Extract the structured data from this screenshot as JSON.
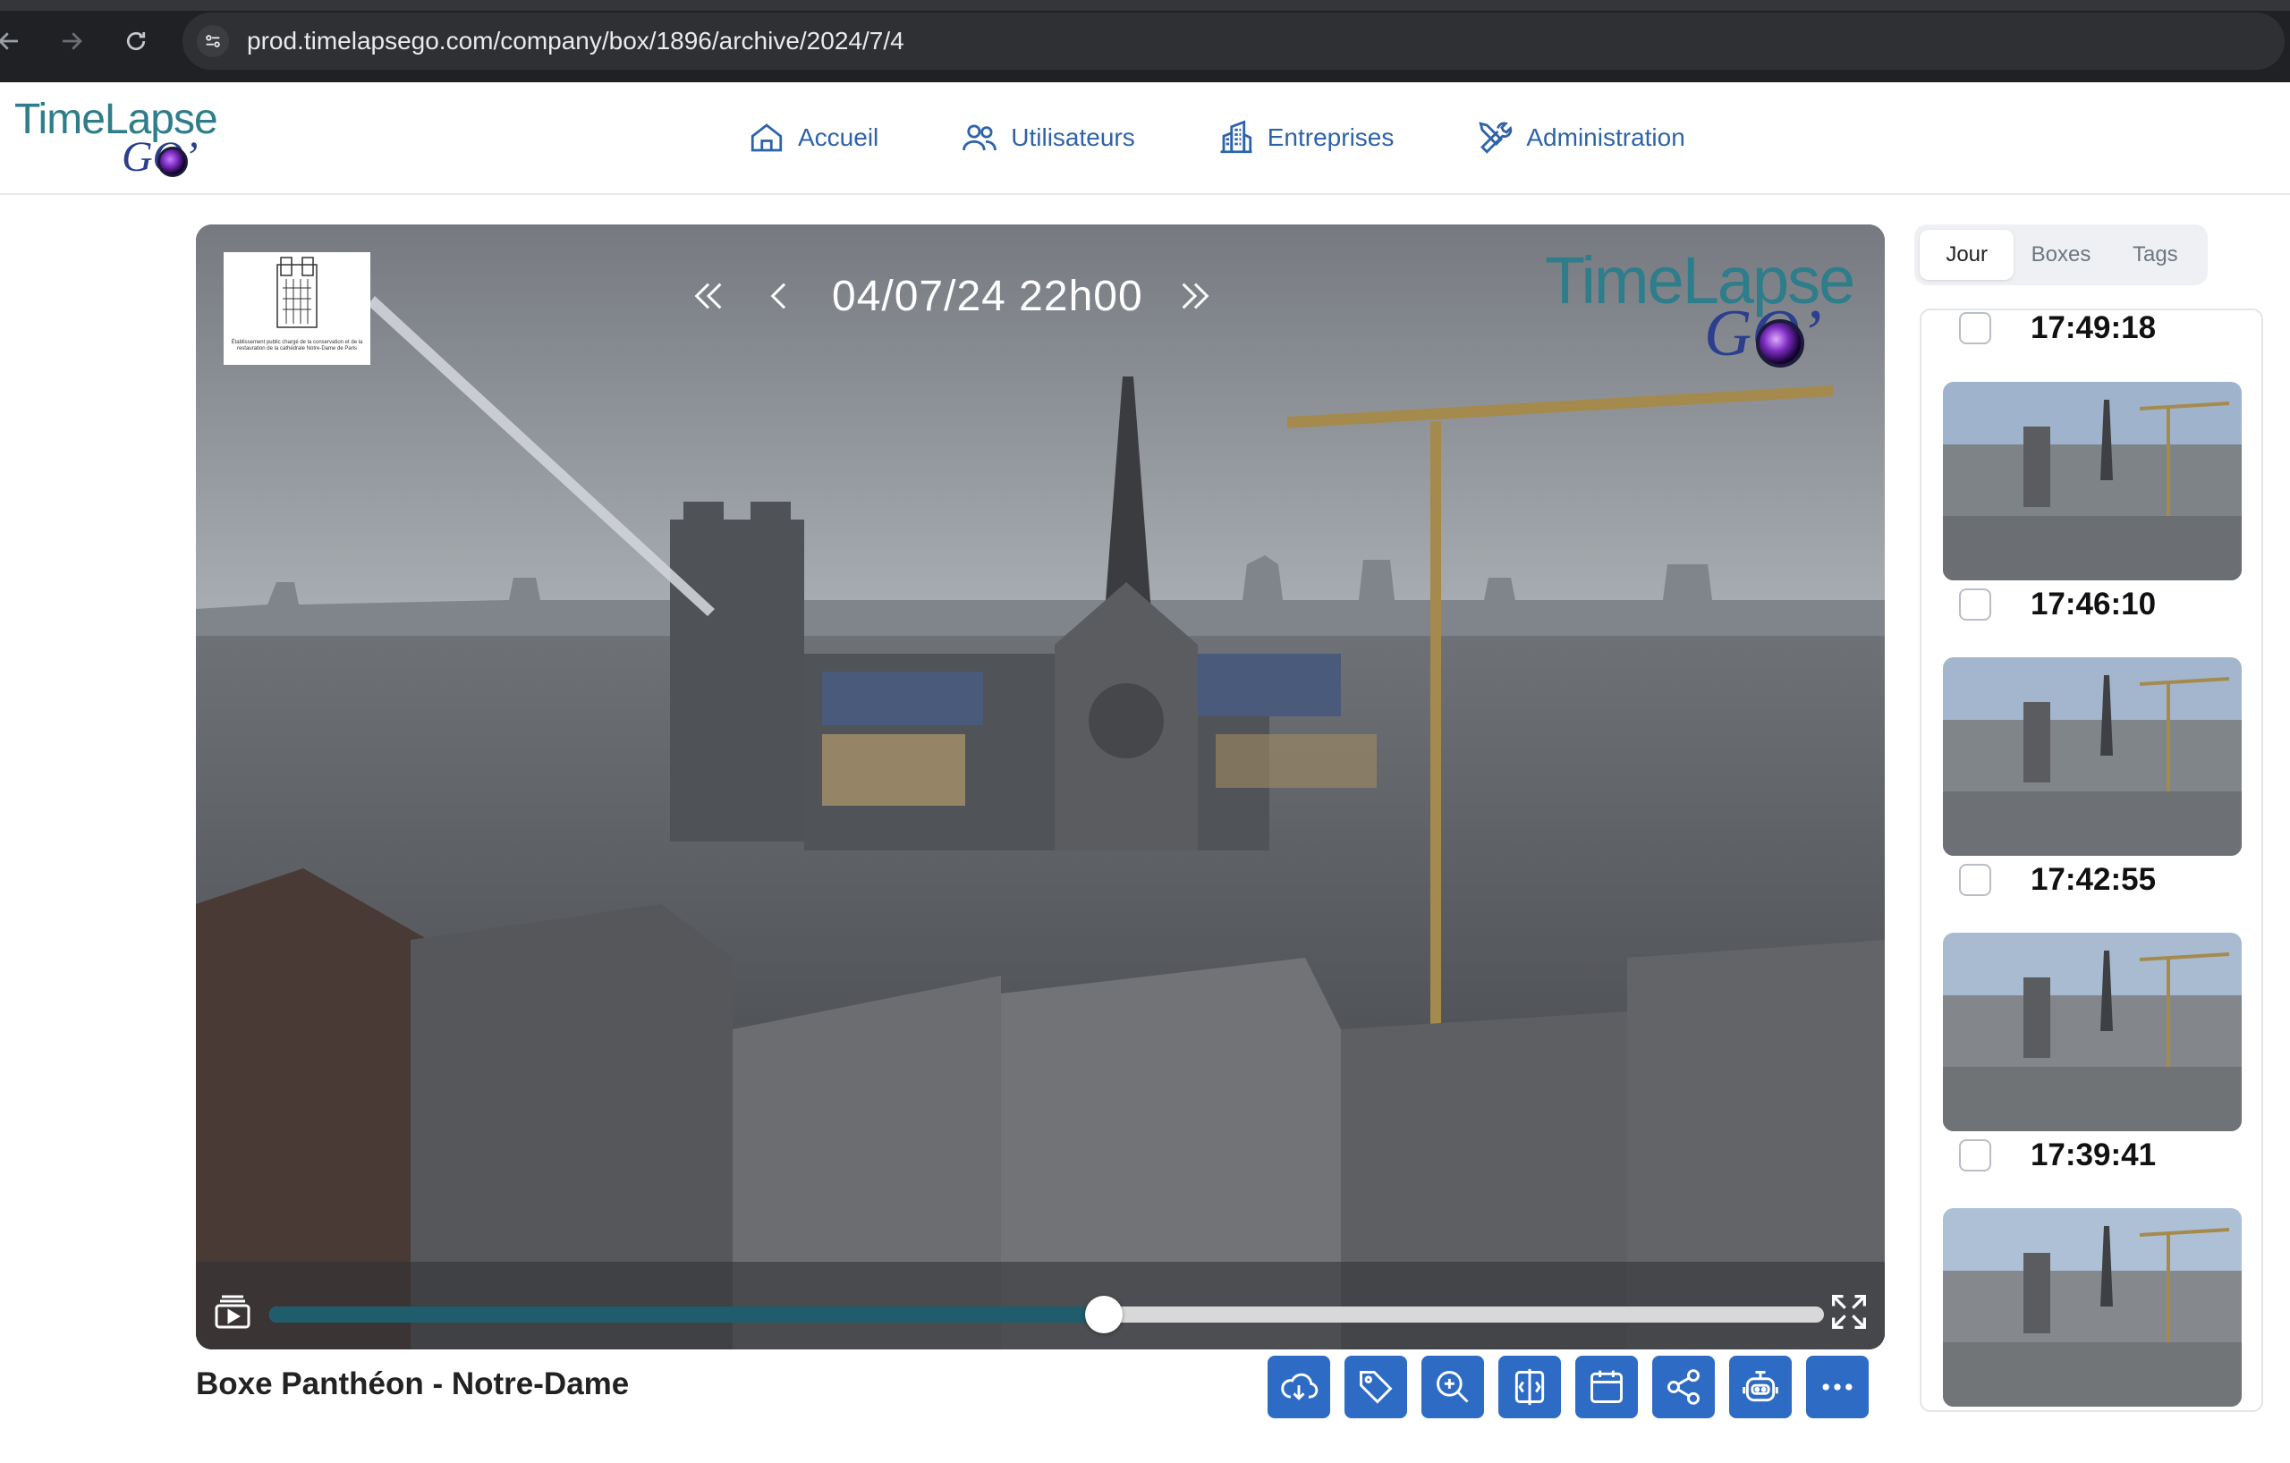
{
  "browser": {
    "url": "prod.timelapsego.com/company/box/1896/archive/2024/7/4",
    "icons": [
      "back-icon",
      "forward-icon",
      "reload-icon",
      "site-info-icon"
    ]
  },
  "header": {
    "logo": {
      "line1": "TimeLapse",
      "line2": "GO’"
    },
    "nav": [
      {
        "label": "Accueil",
        "icon": "home-icon"
      },
      {
        "label": "Utilisateurs",
        "icon": "users-icon"
      },
      {
        "label": "Entreprises",
        "icon": "buildings-icon"
      },
      {
        "label": "Administration",
        "icon": "tools-icon"
      }
    ]
  },
  "viewer": {
    "datetime": "04/07/24 22h00",
    "client_logo_text": "Établissement public chargé de la conservation et de la restauration de la cathédrale Notre-Dame de Paris",
    "watermark": {
      "line1": "TimeLapse",
      "line2": "GO’"
    },
    "progress": 0.537,
    "box_title": "Boxe Panthéon - Notre-Dame",
    "toolbar": [
      "download-cloud-icon",
      "tag-icon",
      "zoom-in-icon",
      "compare-icon",
      "calendar-icon",
      "share-icon",
      "robot-icon",
      "more-icon"
    ]
  },
  "sidebar": {
    "tabs": [
      {
        "label": "Jour",
        "active": true
      },
      {
        "label": "Boxes",
        "active": false
      },
      {
        "label": "Tags",
        "active": false
      }
    ],
    "thumbnails": [
      {
        "time": "17:49:18"
      },
      {
        "time": "17:46:10"
      },
      {
        "time": "17:42:55"
      },
      {
        "time": "17:39:41"
      },
      {
        "time": ""
      }
    ]
  },
  "colors": {
    "accent_blue": "#2d6bc4",
    "nav_blue": "#2d63a8",
    "slider_fill": "#1f5c6c",
    "logo_teal": "#2e7d8a",
    "logo_navy": "#2b3f8e"
  }
}
